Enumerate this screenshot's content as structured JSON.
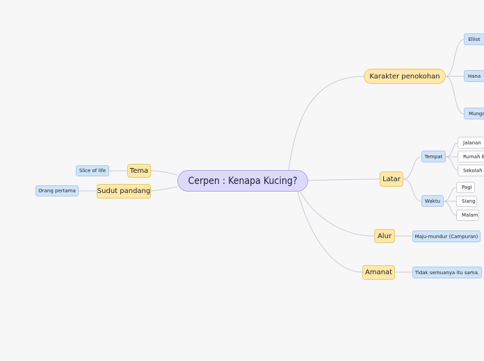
{
  "root": "Cerpen : Kenapa Kucing?",
  "branches": {
    "karakter": {
      "label": "Karakter penokohan",
      "children": [
        "Elliot",
        "Hana",
        "Mungchi"
      ]
    },
    "latar": {
      "label": "Latar",
      "tempat": {
        "label": "Tempat",
        "children": [
          "Jalanan",
          "Rumah Elliot",
          "Sekolah"
        ]
      },
      "waktu": {
        "label": "Waktu",
        "children": [
          "Pagi",
          "Siang",
          "Malam"
        ]
      }
    },
    "alur": {
      "label": "Alur",
      "child": "Maju-mundur (Campuran)"
    },
    "amanat": {
      "label": "Amanat",
      "child": "Tidak semuanya itu sama."
    },
    "tema": {
      "label": "Tema",
      "child": "Slice of life"
    },
    "sudut": {
      "label": "Sudut pandang",
      "child": "Orang pertama"
    }
  },
  "colors": {
    "root_fill": "#dcd9fb",
    "main_topic_fill": "#fde8a8",
    "subtopic_fill": "#cfe4fb",
    "leaf_fill": "#ffffff",
    "connector": "#c9c9d3"
  }
}
